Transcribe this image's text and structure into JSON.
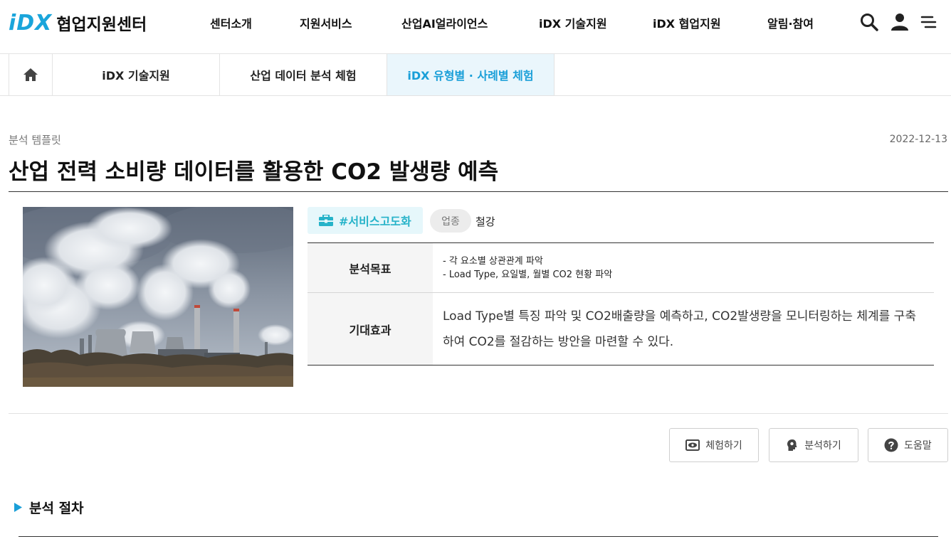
{
  "header": {
    "logo_mark": "iDX",
    "logo_text": "협업지원센터",
    "nav": [
      "센터소개",
      "지원서비스",
      "산업AI얼라이언스",
      "iDX 기술지원",
      "iDX 협업지원",
      "알림·참여"
    ],
    "icons": [
      "search-icon",
      "user-icon",
      "menu-icon"
    ],
    "brand_color": "#1aa5db"
  },
  "breadcrumb": {
    "home_icon": "home-icon",
    "items": [
      "iDX 기술지원",
      "산업 데이터 분석 체험",
      "iDX 유형별 · 사례별 체험"
    ],
    "active_index": 2,
    "active_color": "#1a9fd8"
  },
  "article": {
    "category": "분석 템플릿",
    "date": "2022-12-13",
    "title": "산업 전력 소비량 데이터를 활용한 CO2 발생량 예측",
    "image_alt": "power-plant-photo",
    "tag_primary": "#서비스고도화",
    "tag_primary_icon": "toolbox-icon",
    "industry_label": "업종",
    "industry_value": "철강",
    "rows": [
      {
        "label": "분석목표",
        "lines": [
          "- 각 요소별 상관관계 파악",
          "- Load Type, 요일별, 월별 CO2 현황 파악"
        ]
      },
      {
        "label": "기대효과",
        "text": "Load Type별 특징 파악 및 CO2배출량을 예측하고, CO2발생량을 모니터링하는 체계를 구축하여 CO2를 절감하는 방안을 마련할 수 있다."
      }
    ]
  },
  "actions": {
    "experience": "체험하기",
    "analyze": "분석하기",
    "help": "도움말"
  },
  "section": {
    "title": "분석 절차"
  }
}
